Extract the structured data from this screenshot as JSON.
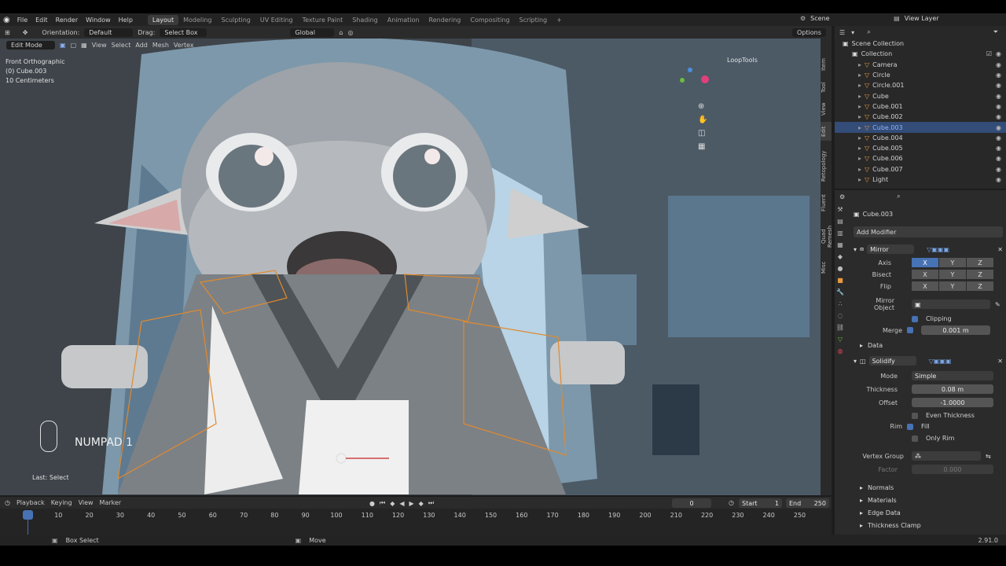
{
  "topbar": {
    "menus": [
      "File",
      "Edit",
      "Render",
      "Window",
      "Help"
    ],
    "workspaces": [
      "Layout",
      "Modeling",
      "Sculpting",
      "UV Editing",
      "Texture Paint",
      "Shading",
      "Animation",
      "Rendering",
      "Compositing",
      "Scripting"
    ],
    "active_workspace": "Layout",
    "scene": "Scene",
    "view_layer": "View Layer"
  },
  "viewport_header": {
    "orientation_label": "Orientation:",
    "orientation_value": "Default",
    "drag_label": "Drag:",
    "drag_value": "Select Box",
    "transform_value": "Global",
    "options": "Options"
  },
  "viewport_bar": {
    "mode": "Edit Mode",
    "menus": [
      "View",
      "Select",
      "Add",
      "Mesh",
      "Vertex"
    ]
  },
  "viewport_overlay": {
    "view_name": "Front Orthographic",
    "object_line": "(0) Cube.003",
    "scale": "10 Centimeters",
    "numpad_text": "NUMPAD 1",
    "last_op": "Last: Select",
    "looptools": "LoopTools"
  },
  "sidetabs": [
    "Item",
    "Tool",
    "View",
    "Edit",
    "Retopology",
    "Fluent",
    "Quad Remesh",
    "Misc"
  ],
  "outliner": {
    "title": "Scene Collection",
    "collection": "Collection",
    "items": [
      {
        "name": "Camera",
        "selected": false
      },
      {
        "name": "Circle",
        "selected": false
      },
      {
        "name": "Circle.001",
        "selected": false
      },
      {
        "name": "Cube",
        "selected": false
      },
      {
        "name": "Cube.001",
        "selected": false
      },
      {
        "name": "Cube.002",
        "selected": false
      },
      {
        "name": "Cube.003",
        "selected": true
      },
      {
        "name": "Cube.004",
        "selected": false
      },
      {
        "name": "Cube.005",
        "selected": false
      },
      {
        "name": "Cube.006",
        "selected": false
      },
      {
        "name": "Cube.007",
        "selected": false
      },
      {
        "name": "Light",
        "selected": false
      }
    ]
  },
  "properties": {
    "object_name": "Cube.003",
    "add_modifier": "Add Modifier",
    "mirror": {
      "name": "Mirror",
      "axis_label": "Axis",
      "bisect_label": "Bisect",
      "flip_label": "Flip",
      "xyz": [
        "X",
        "Y",
        "Z"
      ],
      "mirror_object_label": "Mirror Object",
      "clipping_label": "Clipping",
      "merge_label": "Merge",
      "merge_value": "0.001 m",
      "data_label": "Data"
    },
    "solidify": {
      "name": "Solidify",
      "mode_label": "Mode",
      "mode_value": "Simple",
      "thickness_label": "Thickness",
      "thickness_value": "0.08 m",
      "offset_label": "Offset",
      "offset_value": "-1.0000",
      "even_thickness": "Even Thickness",
      "rim_label": "Rim",
      "fill_label": "Fill",
      "only_rim": "Only Rim",
      "vertex_group_label": "Vertex Group",
      "factor_label": "Factor",
      "factor_value": "0.000",
      "subpanels": [
        "Normals",
        "Materials",
        "Edge Data",
        "Thickness Clamp"
      ]
    }
  },
  "timeline": {
    "menus": [
      "Playback",
      "Keying",
      "View",
      "Marker"
    ],
    "current_frame": "0",
    "start_label": "Start",
    "start": "1",
    "end_label": "End",
    "end": "250",
    "ticks": [
      "0",
      "10",
      "20",
      "30",
      "40",
      "50",
      "60",
      "70",
      "80",
      "90",
      "100",
      "110",
      "120",
      "130",
      "140",
      "150",
      "160",
      "170",
      "180",
      "190",
      "200",
      "210",
      "220",
      "230",
      "240",
      "250"
    ]
  },
  "statusbar": {
    "left": "Box Select",
    "middle": "Move",
    "version": "2.91.0"
  },
  "colors": {
    "accent": "#4772b3",
    "selection": "#334c78",
    "edge_highlight": "#e08a2e"
  }
}
